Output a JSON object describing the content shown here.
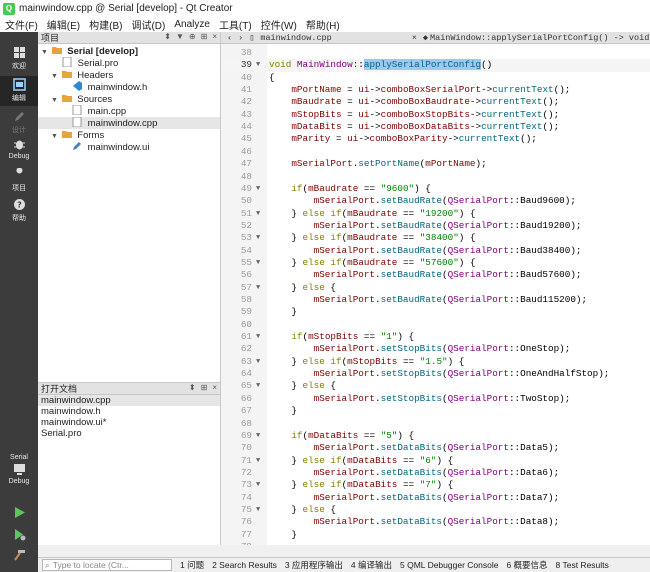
{
  "window": {
    "title": "mainwindow.cpp @ Serial [develop] - Qt Creator"
  },
  "menu": [
    "文件(F)",
    "编辑(E)",
    "构建(B)",
    "调试(D)",
    "Analyze",
    "工具(T)",
    "控件(W)",
    "帮助(H)"
  ],
  "modes": [
    {
      "label": "欢迎"
    },
    {
      "label": "编辑"
    },
    {
      "label": "设计"
    },
    {
      "label": "Debug"
    },
    {
      "label": "项目"
    },
    {
      "label": "帮助"
    }
  ],
  "target": {
    "project": "Serial",
    "config": "Debug"
  },
  "projects_pane": {
    "title": "项目",
    "tree": [
      {
        "text": "Serial [develop]",
        "bold": true
      },
      {
        "text": "Serial.pro"
      },
      {
        "text": "Headers"
      },
      {
        "text": "mainwindow.h"
      },
      {
        "text": "Sources"
      },
      {
        "text": "main.cpp"
      },
      {
        "text": "mainwindow.cpp"
      },
      {
        "text": "Forms"
      },
      {
        "text": "mainwindow.ui"
      }
    ]
  },
  "open_docs": {
    "title": "打开文档",
    "items": [
      "mainwindow.cpp",
      "mainwindow.h",
      "mainwindow.ui*",
      "Serial.pro"
    ]
  },
  "editor": {
    "file_tab": "mainwindow.cpp",
    "symbol": "MainWindow::applySerialPortConfig() -> void",
    "lines": [
      {
        "n": "38",
        "t": ""
      },
      {
        "n": "39",
        "t": "void MainWindow::applySerialPortConfig()"
      },
      {
        "n": "40",
        "t": "{"
      },
      {
        "n": "41",
        "t": "    mPortName = ui->comboBoxSerialPort->currentText();"
      },
      {
        "n": "42",
        "t": "    mBaudrate = ui->comboBoxBaudrate->currentText();"
      },
      {
        "n": "43",
        "t": "    mStopBits = ui->comboBoxStopBits->currentText();"
      },
      {
        "n": "44",
        "t": "    mDataBits = ui->comboBoxDataBits->currentText();"
      },
      {
        "n": "45",
        "t": "    mParity = ui->comboBoxParity->currentText();"
      },
      {
        "n": "46",
        "t": ""
      },
      {
        "n": "47",
        "t": "    mSerialPort.setPortName(mPortName);"
      },
      {
        "n": "48",
        "t": ""
      },
      {
        "n": "49",
        "t": "    if(mBaudrate == \"9600\") {"
      },
      {
        "n": "50",
        "t": "        mSerialPort.setBaudRate(QSerialPort::Baud9600);"
      },
      {
        "n": "51",
        "t": "    } else if(mBaudrate == \"19200\") {"
      },
      {
        "n": "52",
        "t": "        mSerialPort.setBaudRate(QSerialPort::Baud19200);"
      },
      {
        "n": "53",
        "t": "    } else if(mBaudrate == \"38400\") {"
      },
      {
        "n": "54",
        "t": "        mSerialPort.setBaudRate(QSerialPort::Baud38400);"
      },
      {
        "n": "55",
        "t": "    } else if(mBaudrate == \"57600\") {"
      },
      {
        "n": "56",
        "t": "        mSerialPort.setBaudRate(QSerialPort::Baud57600);"
      },
      {
        "n": "57",
        "t": "    } else {"
      },
      {
        "n": "58",
        "t": "        mSerialPort.setBaudRate(QSerialPort::Baud115200);"
      },
      {
        "n": "59",
        "t": "    }"
      },
      {
        "n": "60",
        "t": ""
      },
      {
        "n": "61",
        "t": "    if(mStopBits == \"1\") {"
      },
      {
        "n": "62",
        "t": "        mSerialPort.setStopBits(QSerialPort::OneStop);"
      },
      {
        "n": "63",
        "t": "    } else if(mStopBits == \"1.5\") {"
      },
      {
        "n": "64",
        "t": "        mSerialPort.setStopBits(QSerialPort::OneAndHalfStop);"
      },
      {
        "n": "65",
        "t": "    } else {"
      },
      {
        "n": "66",
        "t": "        mSerialPort.setStopBits(QSerialPort::TwoStop);"
      },
      {
        "n": "67",
        "t": "    }"
      },
      {
        "n": "68",
        "t": ""
      },
      {
        "n": "69",
        "t": "    if(mDataBits == \"5\") {"
      },
      {
        "n": "70",
        "t": "        mSerialPort.setDataBits(QSerialPort::Data5);"
      },
      {
        "n": "71",
        "t": "    } else if(mDataBits == \"6\") {"
      },
      {
        "n": "72",
        "t": "        mSerialPort.setDataBits(QSerialPort::Data6);"
      },
      {
        "n": "73",
        "t": "    } else if(mDataBits == \"7\") {"
      },
      {
        "n": "74",
        "t": "        mSerialPort.setDataBits(QSerialPort::Data7);"
      },
      {
        "n": "75",
        "t": "    } else {"
      },
      {
        "n": "76",
        "t": "        mSerialPort.setDataBits(QSerialPort::Data8);"
      },
      {
        "n": "77",
        "t": "    }"
      },
      {
        "n": "78",
        "t": ""
      }
    ]
  },
  "statusbar": {
    "locator_placeholder": "Type to locate (Ctr...",
    "tabs": [
      "1 问题",
      "2 Search Results",
      "3 应用程序输出",
      "4 编译输出",
      "5 QML Debugger Console",
      "6 概要信息",
      "8 Test Results"
    ]
  }
}
